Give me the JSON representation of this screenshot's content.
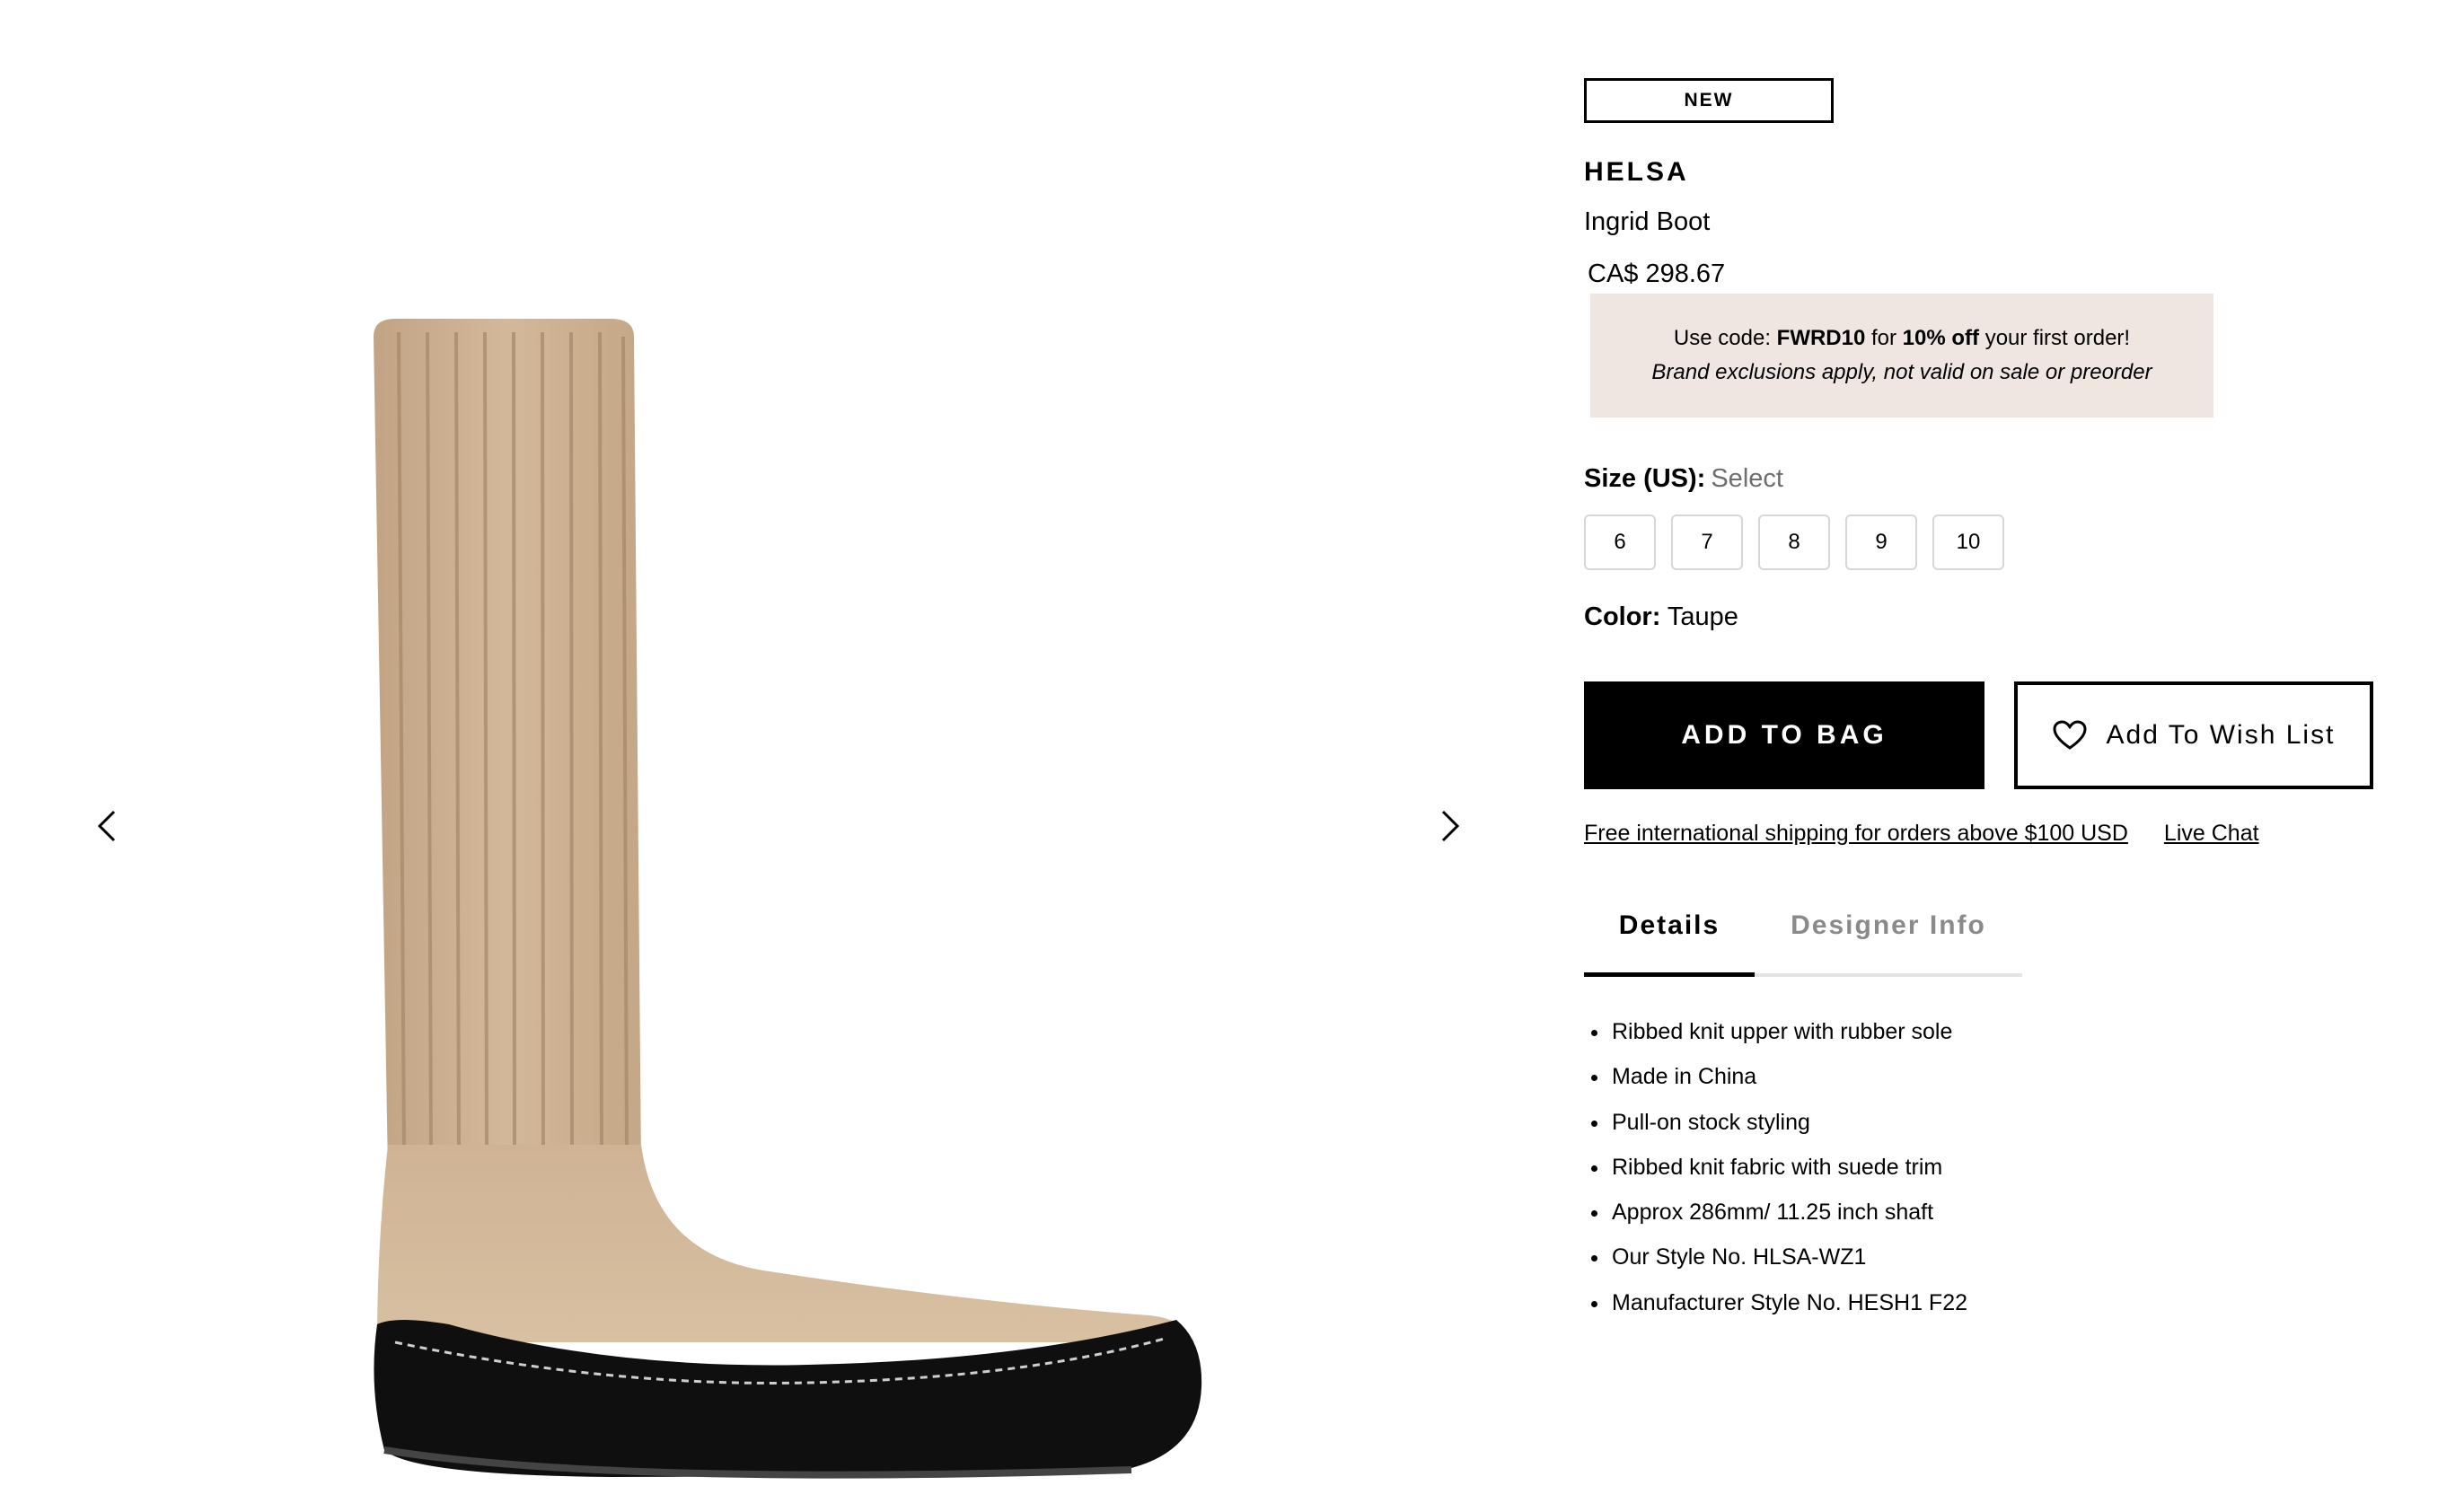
{
  "gallery": {
    "prev_icon": "chevron-left-icon",
    "next_icon": "chevron-right-icon",
    "image_subject": "boot-image"
  },
  "product": {
    "badge": "NEW",
    "brand": "HELSA",
    "name": "Ingrid Boot",
    "price": "CA$ 298.67"
  },
  "promo": {
    "prefix": "Use code: ",
    "code": "FWRD10",
    "middle": " for ",
    "discount": "10% off",
    "suffix": " your first order!",
    "note": "Brand exclusions apply, not valid on sale or preorder",
    "background": "#f0e6e1"
  },
  "size": {
    "label": "Size (US):",
    "placeholder": "Select",
    "options": [
      "6",
      "7",
      "8",
      "9",
      "10"
    ]
  },
  "color": {
    "label": "Color:",
    "value": "Taupe"
  },
  "actions": {
    "add_to_bag": "ADD TO BAG",
    "wishlist": "Add To Wish List",
    "wishlist_icon": "heart-icon"
  },
  "links": {
    "shipping": "Free international shipping for orders above $100 USD",
    "live_chat": "Live Chat"
  },
  "tabs": {
    "details": "Details",
    "designer_info": "Designer Info",
    "active": "Details"
  },
  "details": [
    "Ribbed knit upper with rubber sole",
    "Made in China",
    "Pull-on stock styling",
    "Ribbed knit fabric with suede trim",
    "Approx 286mm/ 11.25 inch shaft",
    "Our Style No. HLSA-WZ1",
    "Manufacturer Style No. HESH1 F22"
  ]
}
